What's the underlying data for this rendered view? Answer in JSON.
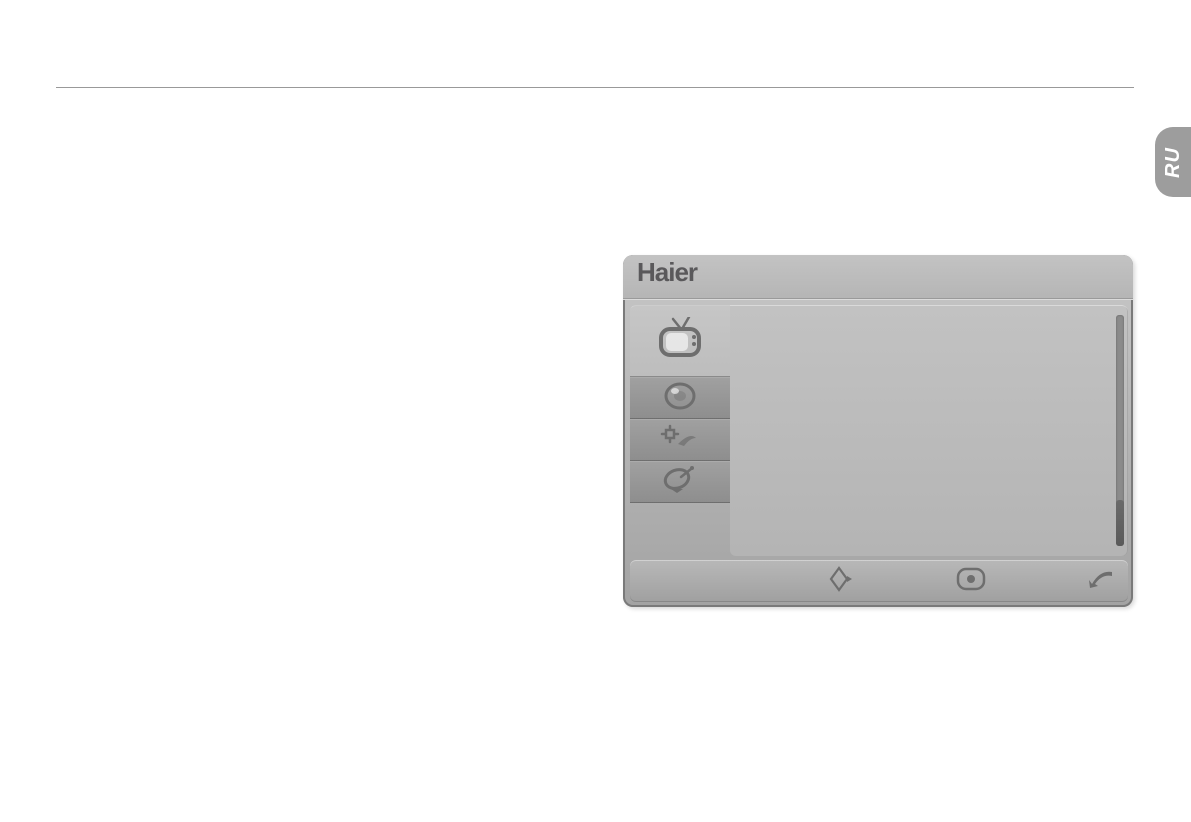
{
  "language_tab": {
    "code": "RU"
  },
  "osd": {
    "title": "Haier",
    "sidebar": {
      "items": [
        {
          "icon": "tv-icon",
          "active": true
        },
        {
          "icon": "speaker-icon",
          "active": false
        },
        {
          "icon": "settings-wrench-icon",
          "active": false
        },
        {
          "icon": "satellite-icon",
          "active": false
        }
      ]
    },
    "content": {
      "arrows": [
        "►",
        "►",
        "►"
      ]
    },
    "footer": {
      "hints": [
        {
          "icon": "nav-diamond-icon"
        },
        {
          "icon": "ok-button-icon"
        },
        {
          "icon": "back-arrow-icon"
        }
      ]
    }
  }
}
